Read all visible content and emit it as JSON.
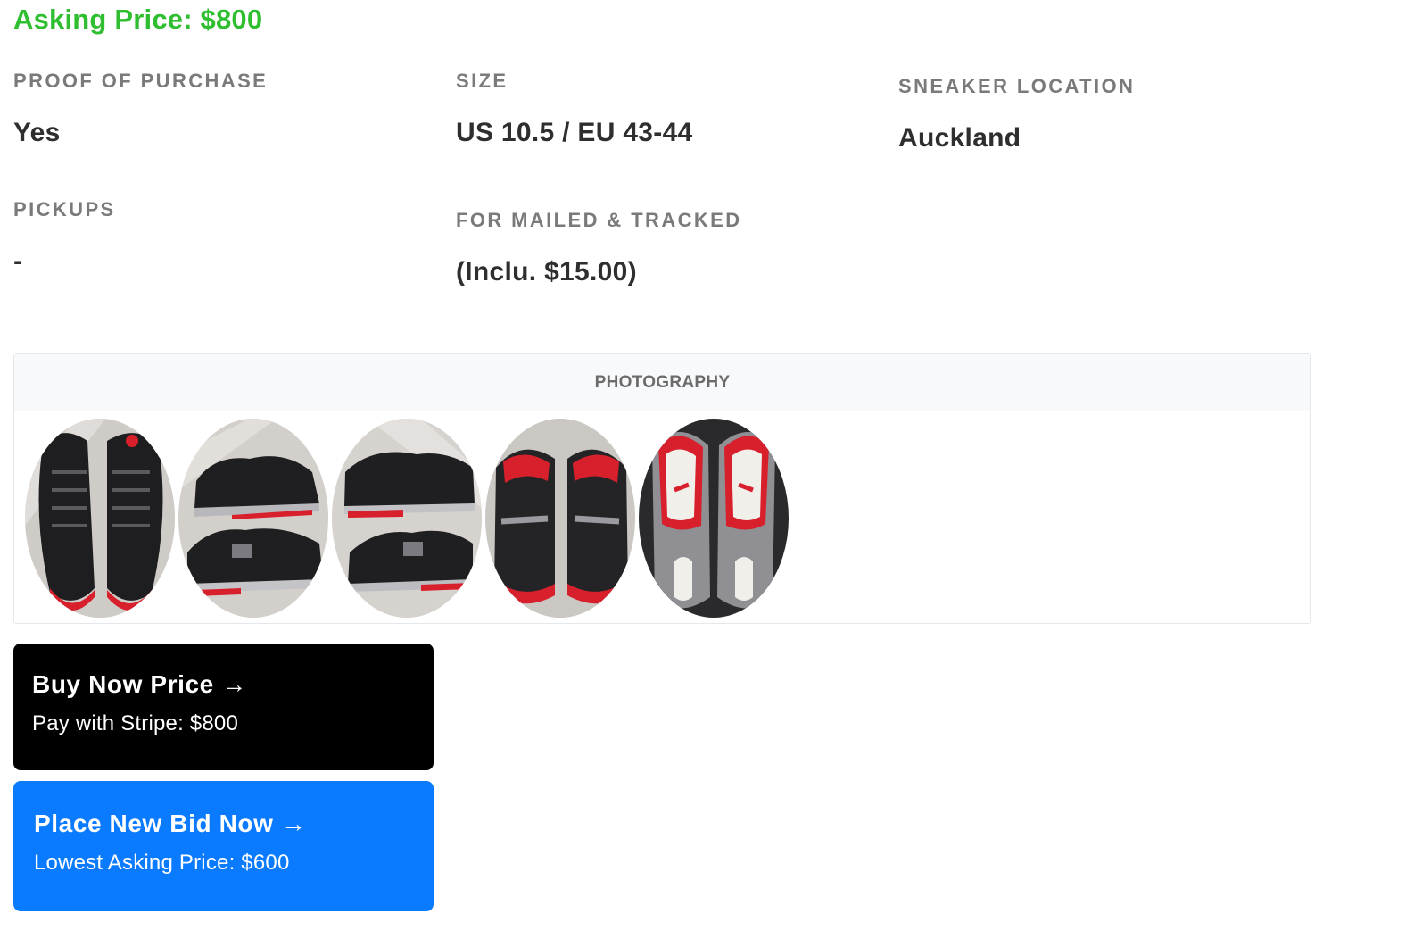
{
  "asking_price": "Asking Price: $800",
  "specs": {
    "proof": {
      "label": "PROOF OF PURCHASE",
      "value": "Yes"
    },
    "size": {
      "label": "SIZE",
      "value": "US 10.5 / EU 43-44"
    },
    "location": {
      "label": "SNEAKER LOCATION",
      "value": "Auckland"
    },
    "pickups": {
      "label": "PICKUPS",
      "value": "-"
    },
    "mailed": {
      "label": "FOR MAILED & TRACKED",
      "value": "(Inclu. $15.00)"
    }
  },
  "photography": {
    "title": "PHOTOGRAPHY",
    "photos": [
      {
        "name": "sneakers-top-view-photo"
      },
      {
        "name": "sneakers-side-view-photo"
      },
      {
        "name": "sneakers-side-view-2-photo"
      },
      {
        "name": "sneakers-heel-view-photo"
      },
      {
        "name": "sneakers-insole-view-photo"
      }
    ]
  },
  "buy_now": {
    "title": "Buy Now Price →",
    "subtitle": "Pay with Stripe: $800"
  },
  "place_bid": {
    "title": "Place New Bid Now →",
    "subtitle": "Lowest Asking Price: $600"
  },
  "colors": {
    "accent_green": "#2fbe2f",
    "buy_button": "#000000",
    "bid_button": "#0a7bff",
    "shoe_red": "#d8202c"
  }
}
